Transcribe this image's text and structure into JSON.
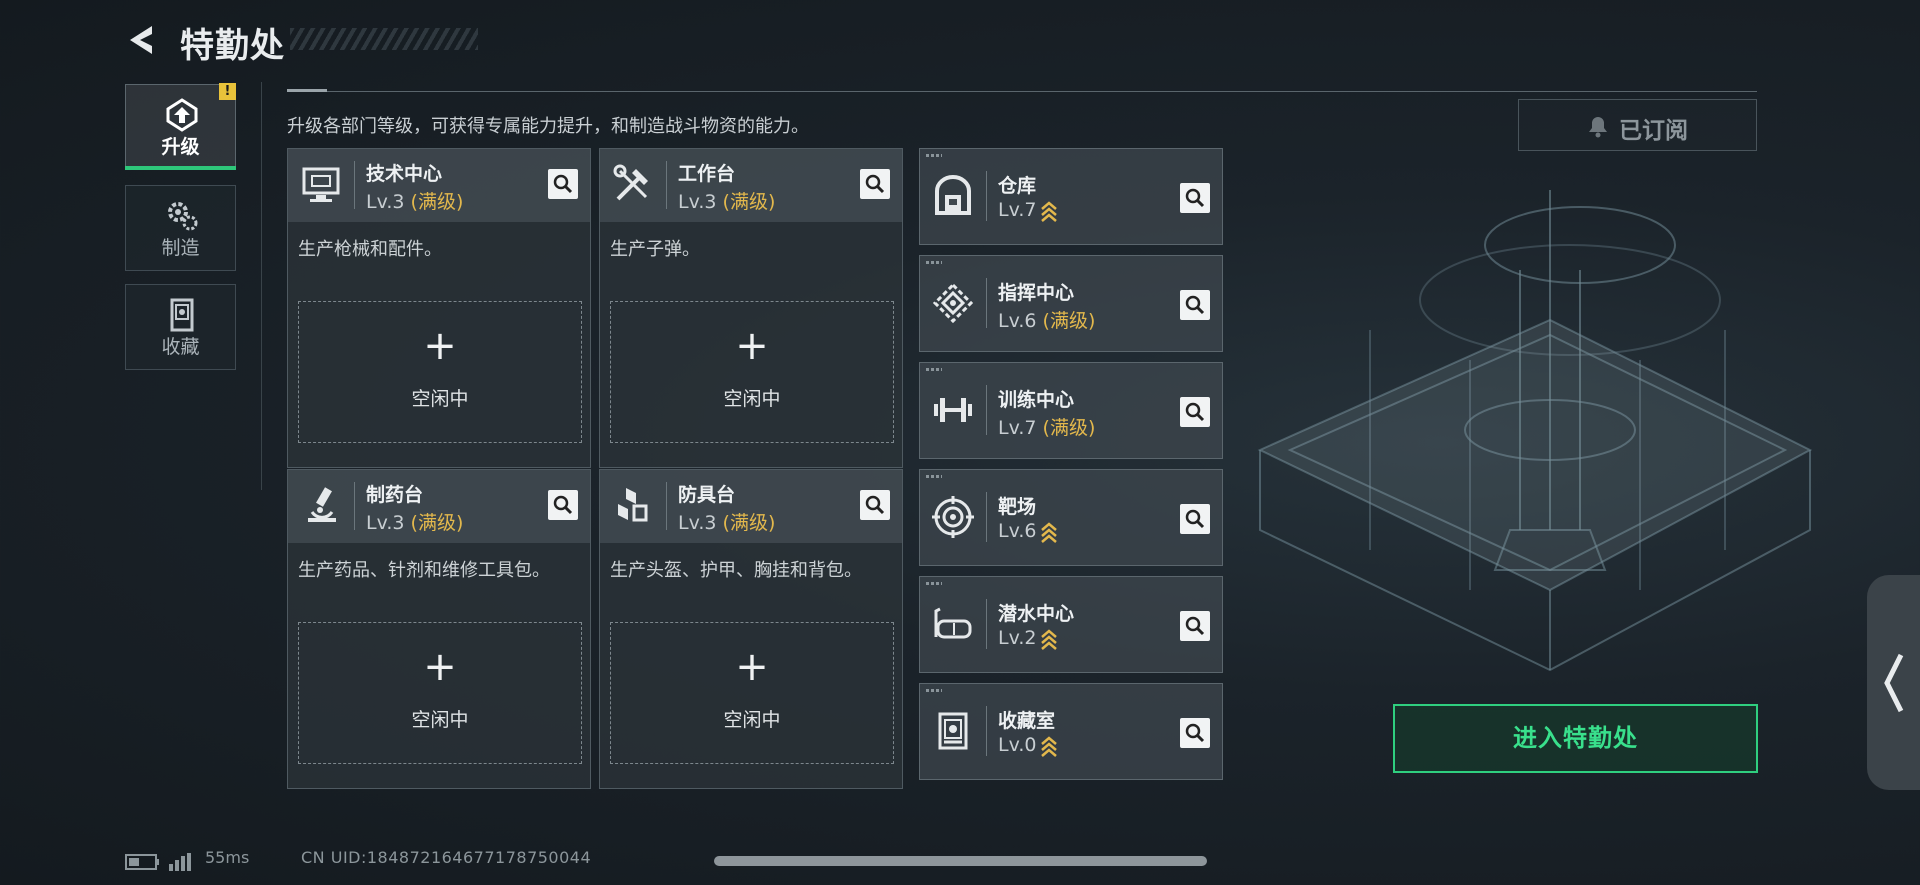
{
  "header": {
    "title": "特勤处"
  },
  "sidebar": {
    "tabs": [
      {
        "label": "升级",
        "active": true,
        "badge": "!"
      },
      {
        "label": "制造",
        "active": false
      },
      {
        "label": "收藏",
        "active": false
      }
    ]
  },
  "description": "升级各部门等级，可获得专属能力提升，和制造战斗物资的能力。",
  "stations": [
    {
      "name": "技术中心",
      "level": "Lv.3",
      "max": "(满级)",
      "desc": "生产枪械和配件。",
      "slot_status": "空闲中",
      "icon": "monitor-icon"
    },
    {
      "name": "工作台",
      "level": "Lv.3",
      "max": "(满级)",
      "desc": "生产子弹。",
      "slot_status": "空闲中",
      "icon": "tools-icon"
    },
    {
      "name": "制药台",
      "level": "Lv.3",
      "max": "(满级)",
      "desc": "生产药品、针剂和维修工具包。",
      "slot_status": "空闲中",
      "icon": "microscope-icon"
    },
    {
      "name": "防具台",
      "level": "Lv.3",
      "max": "(满级)",
      "desc": "生产头盔、护甲、胸挂和背包。",
      "slot_status": "空闲中",
      "icon": "cubes-icon"
    }
  ],
  "facilities": [
    {
      "name": "仓库",
      "level": "Lv.7",
      "max": "",
      "upgradable": true,
      "icon": "warehouse-icon"
    },
    {
      "name": "指挥中心",
      "level": "Lv.6",
      "max": "(满级)",
      "upgradable": false,
      "icon": "command-icon"
    },
    {
      "name": "训练中心",
      "level": "Lv.7",
      "max": "(满级)",
      "upgradable": false,
      "icon": "dumbbell-icon"
    },
    {
      "name": "靶场",
      "level": "Lv.6",
      "max": "",
      "upgradable": true,
      "icon": "target-icon"
    },
    {
      "name": "潜水中心",
      "level": "Lv.2",
      "max": "",
      "upgradable": true,
      "icon": "diving-mask-icon"
    },
    {
      "name": "收藏室",
      "level": "Lv.0",
      "max": "",
      "upgradable": true,
      "icon": "collection-icon"
    }
  ],
  "subscribe": {
    "label": "已订阅"
  },
  "enter_button": {
    "label": "进入特勤处"
  },
  "footer": {
    "ping": "55ms",
    "uid": "CN UID:1848721646771787500​44"
  },
  "colors": {
    "accent_green": "#2fcf7f",
    "max_gold": "#e3b84c",
    "warning_yellow": "#e8c23a"
  }
}
